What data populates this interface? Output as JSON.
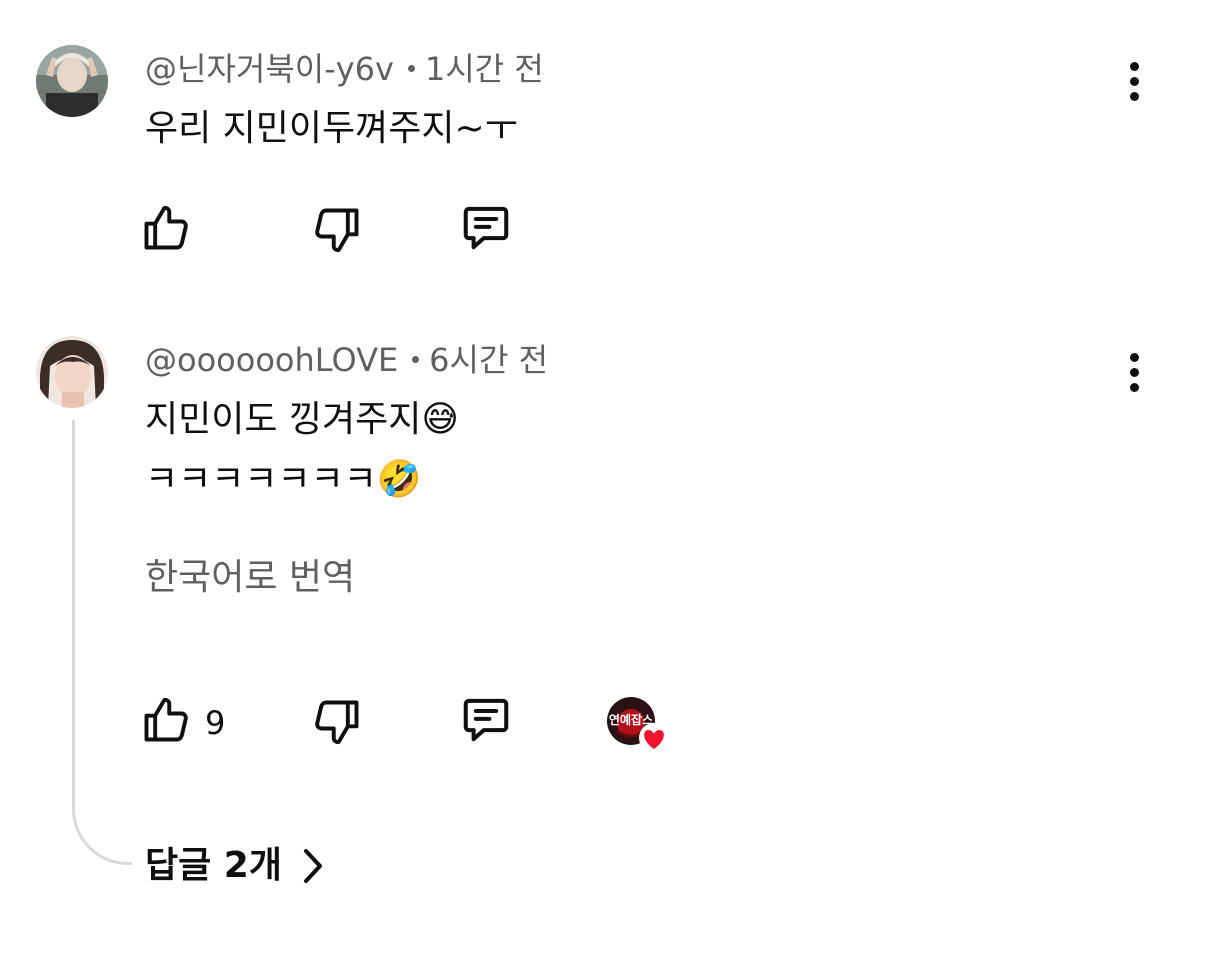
{
  "comments": [
    {
      "author": "@닌자거북이-y6v",
      "time": "1시간 전",
      "lines": [
        "우리 지민이두껴주지~ㅜ"
      ]
    },
    {
      "author": "@oooooohLOVE",
      "time": "6시간 전",
      "lines": [
        "지민이도 낑겨주지😅",
        "ㅋㅋㅋㅋㅋㅋㅋ🤣"
      ],
      "translate_label": "한국어로 번역",
      "like_count": "9",
      "creator_badge_text": "연예잡스",
      "replies_label": "답글 2개"
    }
  ],
  "icons": [
    "more-vert-icon",
    "thumbs-up-icon",
    "thumbs-down-icon",
    "reply-icon",
    "chevron-right-icon",
    "heart-icon"
  ]
}
